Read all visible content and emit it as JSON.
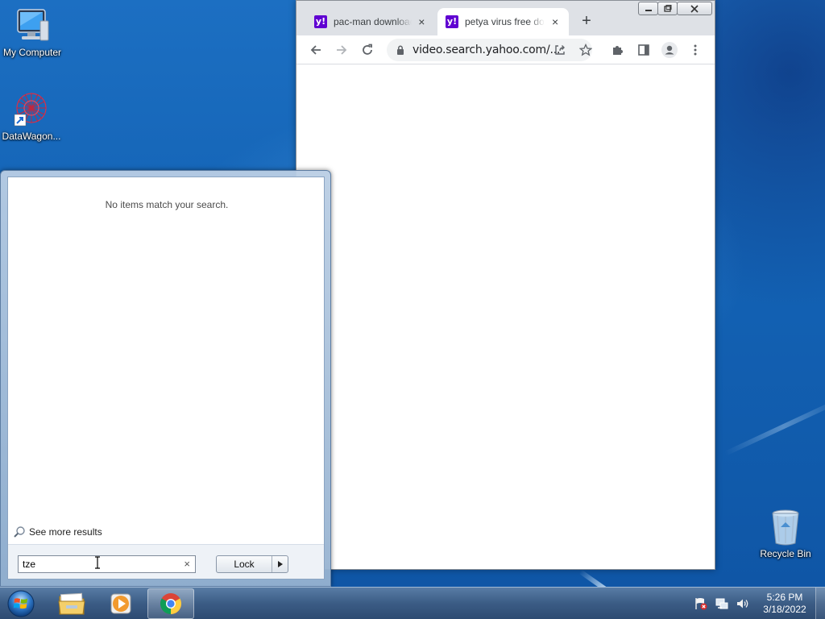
{
  "desktop": {
    "icons": [
      {
        "label": "My Computer",
        "icon": "computer-icon"
      },
      {
        "label": "DataWagon...",
        "icon": "datawagon-icon"
      },
      {
        "label": "Recycle Bin",
        "icon": "recycle-bin-icon"
      }
    ]
  },
  "browser": {
    "tabs": [
      {
        "title": "pac-man download",
        "favicon": "y!",
        "active": false
      },
      {
        "title": "petya virus free do",
        "favicon": "y!",
        "active": true
      }
    ],
    "new_tab": "+",
    "tab_close": "×",
    "url": "video.search.yahoo.com/...",
    "accent": "#6001d2"
  },
  "start_menu": {
    "no_results": "No items match your search.",
    "see_more": "See more results",
    "search_value": "tze",
    "clear": "×",
    "lock_label": "Lock"
  },
  "taskbar": {
    "apps": [
      "windows-explorer-icon",
      "media-player-icon",
      "chrome-icon"
    ],
    "active_app": "chrome-icon",
    "time": "5:26 PM",
    "date": "3/18/2022"
  }
}
